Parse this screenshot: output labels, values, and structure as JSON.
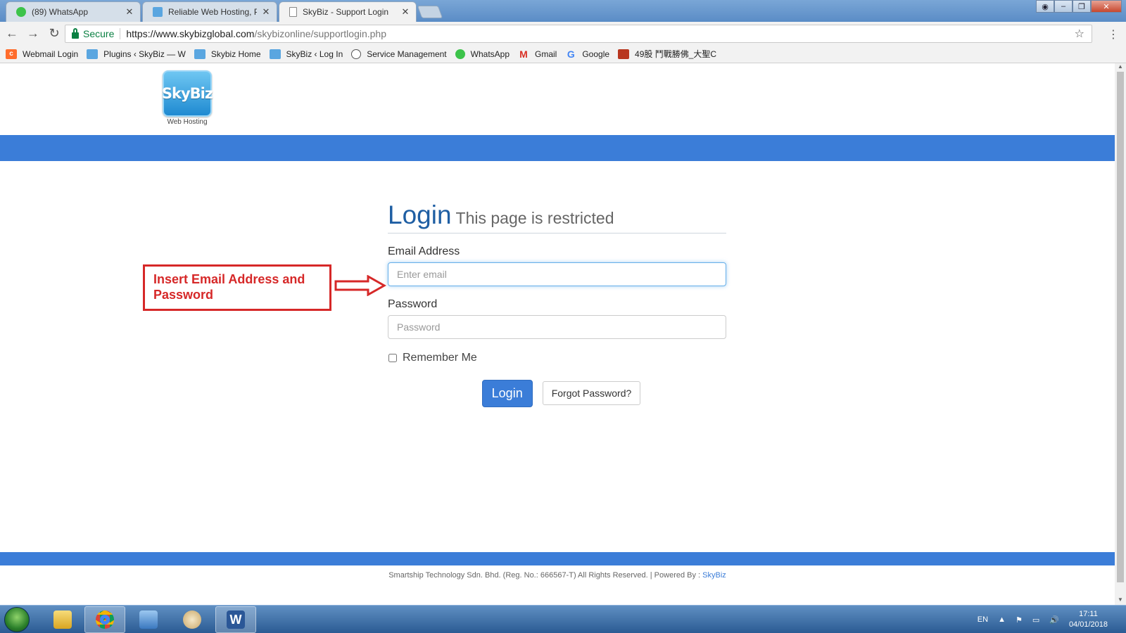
{
  "browser": {
    "tabs": [
      {
        "title": "(89) WhatsApp",
        "active": false,
        "icon": "whatsapp-icon"
      },
      {
        "title": "Reliable Web Hosting, Pr",
        "active": false,
        "icon": "skybiz-icon"
      },
      {
        "title": "SkyBiz - Support Login",
        "active": true,
        "icon": "page-icon"
      }
    ],
    "address": {
      "secure_label": "Secure",
      "url_host": "https://www.skybizglobal.com",
      "url_path": "/skybizonline/supportlogin.php"
    },
    "bookmarks": [
      {
        "label": "Webmail Login",
        "icon": "cpanel-icon"
      },
      {
        "label": "Plugins ‹ SkyBiz — W",
        "icon": "skybiz-icon"
      },
      {
        "label": "Skybiz Home",
        "icon": "skybiz-icon"
      },
      {
        "label": "SkyBiz ‹ Log In",
        "icon": "skybiz-icon"
      },
      {
        "label": "Service Management",
        "icon": "servicenow-icon"
      },
      {
        "label": "WhatsApp",
        "icon": "whatsapp-icon"
      },
      {
        "label": "Gmail",
        "icon": "gmail-icon"
      },
      {
        "label": "Google",
        "icon": "google-icon"
      },
      {
        "label": "49股 鬥戰勝佛_大聖C",
        "icon": "chinese-site-icon"
      }
    ]
  },
  "page": {
    "logo": {
      "text": "SkyBiz",
      "subtitle": "Web Hosting"
    },
    "login": {
      "title": "Login",
      "subtitle": "This page is restricted",
      "email_label": "Email Address",
      "email_placeholder": "Enter email",
      "password_label": "Password",
      "password_placeholder": "Password",
      "remember_label": "Remember Me",
      "login_button": "Login",
      "forgot_button": "Forgot Password?"
    },
    "annotation": {
      "text": "Insert Email Address and Password"
    },
    "footer": {
      "text": "Smartship Technology Sdn. Bhd. (Reg. No.: 666567-T) All Rights Reserved. | Powered By : ",
      "link": "SkyBiz"
    }
  },
  "taskbar": {
    "apps": [
      "file-explorer-icon",
      "chrome-icon",
      "remote-desktop-icon",
      "paint-icon",
      "word-icon"
    ],
    "language": "EN",
    "time": "17:11",
    "date": "04/01/2018"
  },
  "colors": {
    "brand_blue": "#3b7dd8",
    "annotation_red": "#d62828",
    "title_blue": "#1e5ea3"
  }
}
